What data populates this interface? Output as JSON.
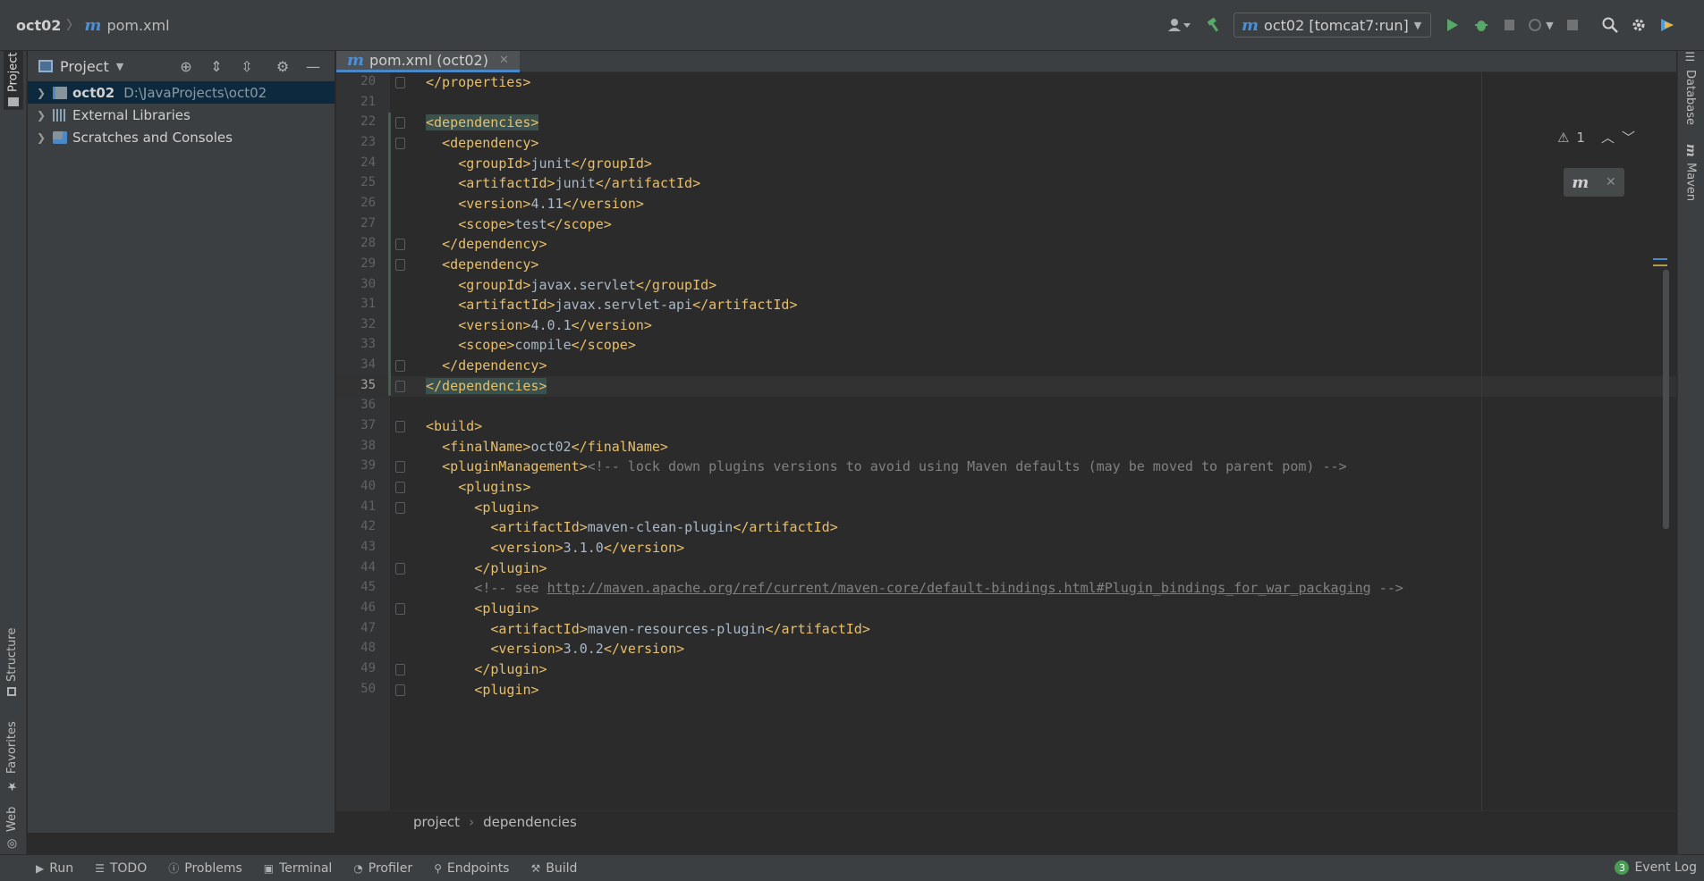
{
  "navbar": {
    "project_name": "oct02",
    "file_name": "pom.xml",
    "run_config": "oct02 [tomcat7:run]"
  },
  "left_strip": {
    "project_tab": "Project",
    "structure_tab": "Structure",
    "favorites_tab": "Favorites",
    "web_tab": "Web"
  },
  "right_strip": {
    "database_tab": "Database",
    "maven_tab": "Maven"
  },
  "project_panel": {
    "title": "Project",
    "items": [
      {
        "label": "oct02",
        "path": "D:\\JavaProjects\\oct02"
      },
      {
        "label": "External Libraries"
      },
      {
        "label": "Scratches and Consoles"
      }
    ]
  },
  "editor": {
    "tab_label": "pom.xml (oct02)",
    "current_line": 35,
    "warnings_count": "1",
    "lines": [
      {
        "n": "20",
        "indent": 0,
        "parts": [
          [
            "tag",
            "</properties>"
          ]
        ]
      },
      {
        "n": "21",
        "indent": 0,
        "parts": []
      },
      {
        "n": "22",
        "indent": 0,
        "parts": [
          [
            "hl",
            "<dependencies>"
          ]
        ]
      },
      {
        "n": "23",
        "indent": 1,
        "parts": [
          [
            "tag",
            "<dependency>"
          ]
        ]
      },
      {
        "n": "24",
        "indent": 2,
        "parts": [
          [
            "tag",
            "<groupId>"
          ],
          [
            "t",
            "junit"
          ],
          [
            "tag",
            "</groupId>"
          ]
        ]
      },
      {
        "n": "25",
        "indent": 2,
        "parts": [
          [
            "tag",
            "<artifactId>"
          ],
          [
            "t",
            "junit"
          ],
          [
            "tag",
            "</artifactId>"
          ]
        ]
      },
      {
        "n": "26",
        "indent": 2,
        "parts": [
          [
            "tag",
            "<version>"
          ],
          [
            "t",
            "4.11"
          ],
          [
            "tag",
            "</version>"
          ]
        ]
      },
      {
        "n": "27",
        "indent": 2,
        "parts": [
          [
            "tag",
            "<scope>"
          ],
          [
            "t",
            "test"
          ],
          [
            "tag",
            "</scope>"
          ]
        ]
      },
      {
        "n": "28",
        "indent": 1,
        "parts": [
          [
            "tag",
            "</dependency>"
          ]
        ]
      },
      {
        "n": "29",
        "indent": 1,
        "parts": [
          [
            "tag",
            "<dependency>"
          ]
        ]
      },
      {
        "n": "30",
        "indent": 2,
        "parts": [
          [
            "tag",
            "<groupId>"
          ],
          [
            "t",
            "javax.servlet"
          ],
          [
            "tag",
            "</groupId>"
          ]
        ]
      },
      {
        "n": "31",
        "indent": 2,
        "parts": [
          [
            "tag",
            "<artifactId>"
          ],
          [
            "t",
            "javax.servlet-api"
          ],
          [
            "tag",
            "</artifactId>"
          ]
        ]
      },
      {
        "n": "32",
        "indent": 2,
        "parts": [
          [
            "tag",
            "<version>"
          ],
          [
            "t",
            "4.0.1"
          ],
          [
            "tag",
            "</version>"
          ]
        ]
      },
      {
        "n": "33",
        "indent": 2,
        "parts": [
          [
            "tag",
            "<scope>"
          ],
          [
            "t",
            "compile"
          ],
          [
            "tag",
            "</scope>"
          ]
        ]
      },
      {
        "n": "34",
        "indent": 1,
        "parts": [
          [
            "tag",
            "</dependency>"
          ]
        ]
      },
      {
        "n": "35",
        "indent": 0,
        "parts": [
          [
            "hl",
            "</dependencies>"
          ]
        ]
      },
      {
        "n": "36",
        "indent": 0,
        "parts": []
      },
      {
        "n": "37",
        "indent": 0,
        "parts": [
          [
            "tag",
            "<build>"
          ]
        ]
      },
      {
        "n": "38",
        "indent": 1,
        "parts": [
          [
            "tag",
            "<finalName>"
          ],
          [
            "t",
            "oct02"
          ],
          [
            "tag",
            "</finalName>"
          ]
        ]
      },
      {
        "n": "39",
        "indent": 1,
        "parts": [
          [
            "tag",
            "<pluginManagement>"
          ],
          [
            "cmt",
            "<!-- lock down plugins versions to avoid using Maven defaults (may be moved to parent pom) -->"
          ]
        ]
      },
      {
        "n": "40",
        "indent": 2,
        "parts": [
          [
            "tag",
            "<plugins>"
          ]
        ]
      },
      {
        "n": "41",
        "indent": 3,
        "parts": [
          [
            "tag",
            "<plugin>"
          ]
        ]
      },
      {
        "n": "42",
        "indent": 4,
        "parts": [
          [
            "tag",
            "<artifactId>"
          ],
          [
            "t",
            "maven-clean-plugin"
          ],
          [
            "tag",
            "</artifactId>"
          ]
        ]
      },
      {
        "n": "43",
        "indent": 4,
        "parts": [
          [
            "tag",
            "<version>"
          ],
          [
            "t",
            "3.1.0"
          ],
          [
            "tag",
            "</version>"
          ]
        ]
      },
      {
        "n": "44",
        "indent": 3,
        "parts": [
          [
            "tag",
            "</plugin>"
          ]
        ]
      },
      {
        "n": "45",
        "indent": 3,
        "parts": [
          [
            "cmt",
            "<!-- see "
          ],
          [
            "url",
            "http://maven.apache.org/ref/current/maven-core/default-bindings.html#Plugin_bindings_for_war_packaging"
          ],
          [
            "cmt",
            " -->"
          ]
        ]
      },
      {
        "n": "46",
        "indent": 3,
        "parts": [
          [
            "tag",
            "<plugin>"
          ]
        ]
      },
      {
        "n": "47",
        "indent": 4,
        "parts": [
          [
            "tag",
            "<artifactId>"
          ],
          [
            "t",
            "maven-resources-plugin"
          ],
          [
            "tag",
            "</artifactId>"
          ]
        ]
      },
      {
        "n": "48",
        "indent": 4,
        "parts": [
          [
            "tag",
            "<version>"
          ],
          [
            "t",
            "3.0.2"
          ],
          [
            "tag",
            "</version>"
          ]
        ]
      },
      {
        "n": "49",
        "indent": 3,
        "parts": [
          [
            "tag",
            "</plugin>"
          ]
        ]
      },
      {
        "n": "50",
        "indent": 3,
        "parts": [
          [
            "tag",
            "<plugin>"
          ]
        ]
      }
    ],
    "folds": [
      "20",
      "22",
      "23",
      "28",
      "29",
      "34",
      "35",
      "37",
      "39",
      "40",
      "41",
      "44",
      "46",
      "49",
      "50"
    ]
  },
  "editor_breadcrumb": {
    "items": [
      "project",
      "dependencies"
    ]
  },
  "bottom_tools": [
    {
      "label": "Run",
      "icon": "run-icon"
    },
    {
      "label": "TODO",
      "icon": "todo-icon"
    },
    {
      "label": "Problems",
      "icon": "problems-icon"
    },
    {
      "label": "Terminal",
      "icon": "terminal-icon"
    },
    {
      "label": "Profiler",
      "icon": "profiler-icon"
    },
    {
      "label": "Endpoints",
      "icon": "endpoints-icon"
    },
    {
      "label": "Build",
      "icon": "build-icon"
    }
  ],
  "event_log": {
    "label": "Event Log",
    "count": "3"
  },
  "colors": {
    "tag": "#e8bf6a",
    "comment": "#808080",
    "text": "#a9b7c6",
    "accent": "#4a88c7",
    "selection": "#0d293e"
  }
}
